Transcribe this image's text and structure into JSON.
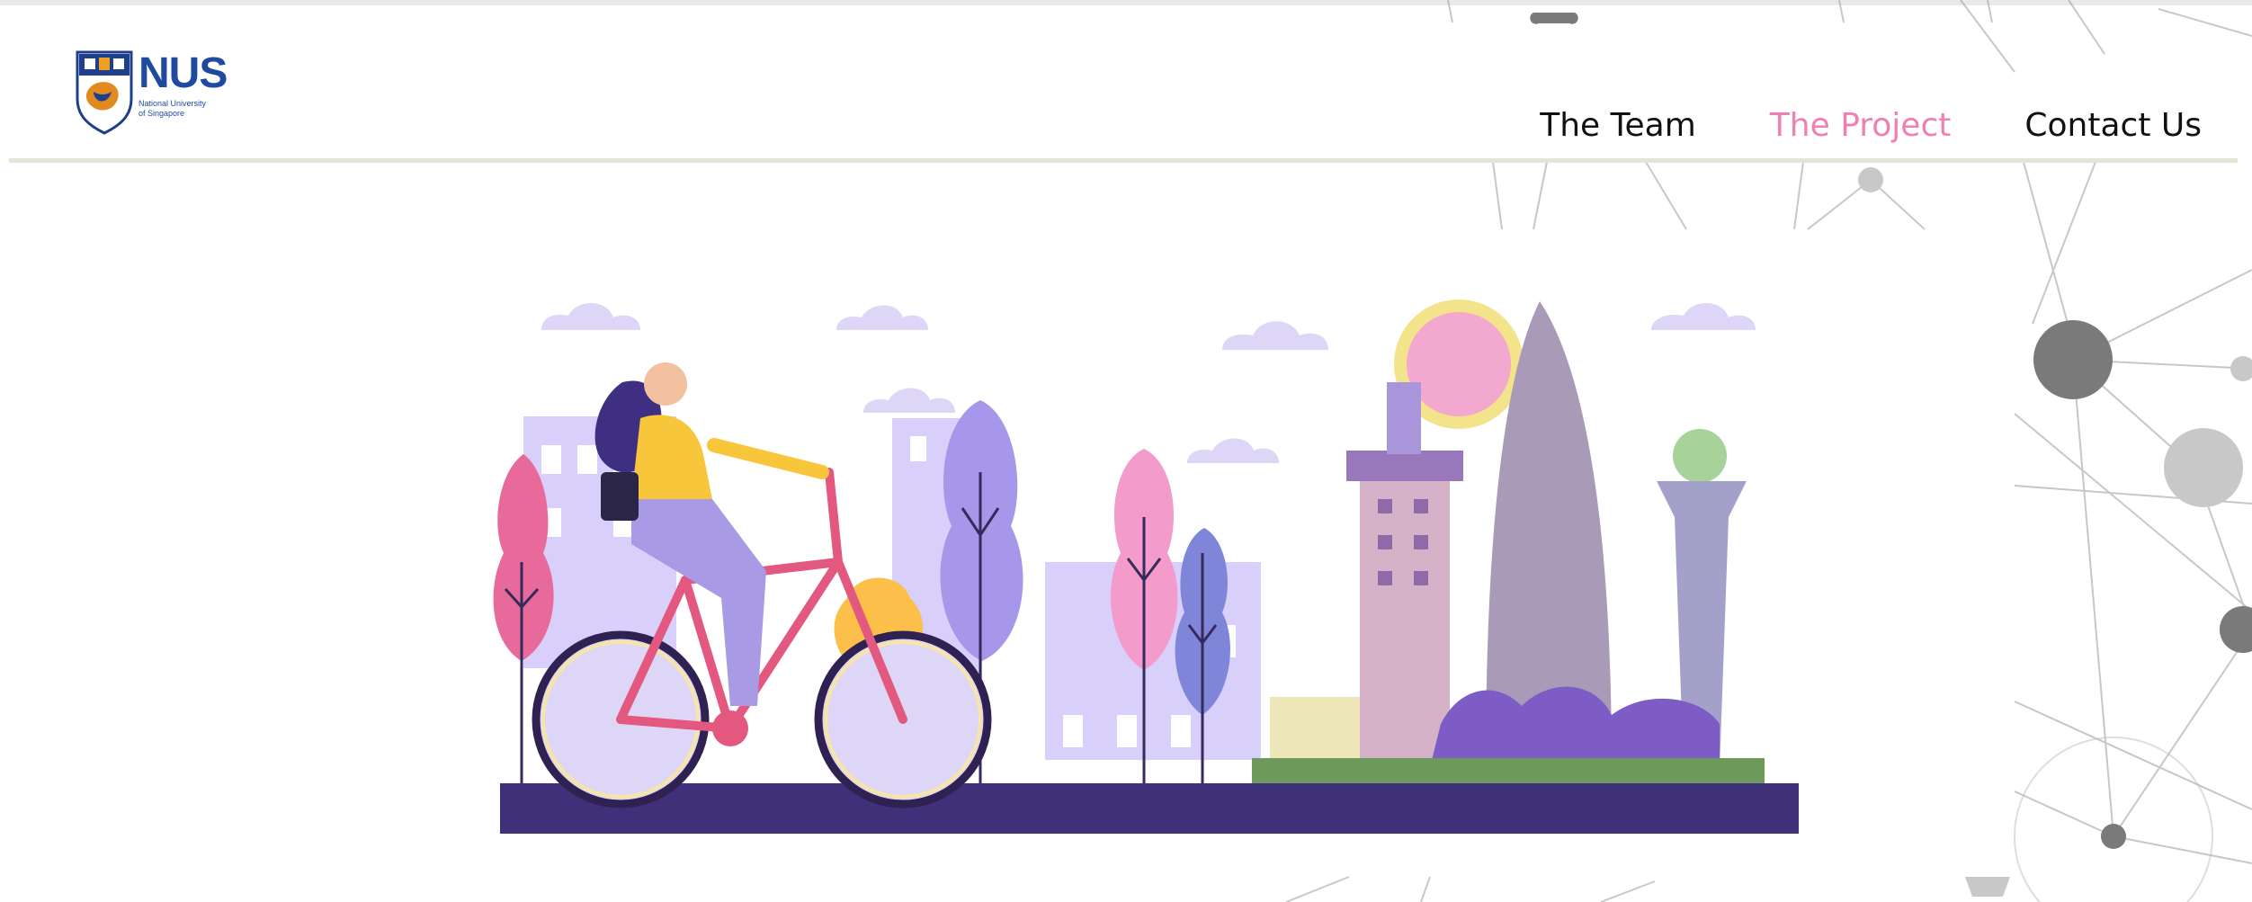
{
  "logo": {
    "name": "NUS",
    "subtitle_line1": "National University",
    "subtitle_line2": "of Singapore"
  },
  "nav": {
    "items": [
      {
        "label": "The Team",
        "active": false
      },
      {
        "label": "The Project",
        "active": true
      },
      {
        "label": "Contact Us",
        "active": false
      }
    ]
  },
  "colors": {
    "active_nav": "#f07fb4",
    "brand_blue": "#1f4aa0",
    "ground": "#40307a",
    "header_rule": "#e3e6d6"
  },
  "hero": {
    "image": "illustration-woman-cycling-city"
  }
}
